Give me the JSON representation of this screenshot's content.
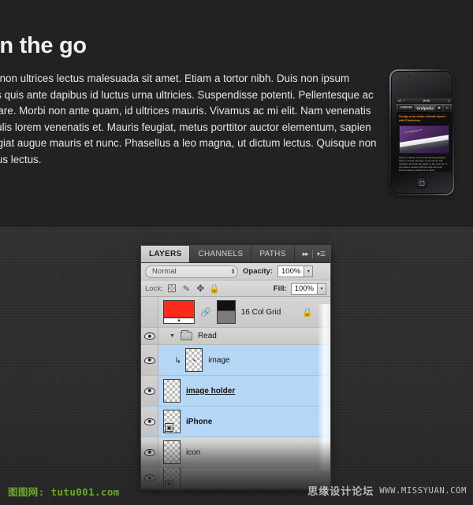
{
  "hero": {
    "heading": "on the go",
    "paragraph_lines": [
      "rci, non ultrices lectus malesuada sit amet. Etiam a tortor nibh. Duis non ipsum",
      "felis quis ante dapibus id luctus urna ultricies. Suspendisse potenti. Pellentesque ac",
      "ornare. Morbi non ante quam, id ultrices mauris. Vivamus ac mi elit. Nam venenatis",
      "iaculis lorem venenatis et. Mauris feugiat, metus porttitor auctor elementum, sapien",
      "feugiat augue mauris et nunc. Phasellus a leo magna, ut dictum lectus. Quisque non",
      "pibus lectus."
    ]
  },
  "phone": {
    "status": {
      "carrier": "ull. ?",
      "time": "18:46"
    },
    "app_bar": {
      "back_label": "Grafpedia",
      "title": "Grafpedia",
      "star_icon": "star-icon",
      "forward_icon": "chevron-right-icon"
    },
    "post": {
      "title": "Design a car dealer website layout with Photoshop",
      "image_caption": "www.grafpedia.com",
      "body": "Hello my friends. From today all things will get back to normal. We have moved all our VIP members from the old system to the new one. If you have a problem with the login and your account please contact us by email."
    }
  },
  "panel": {
    "tabs": [
      {
        "label": "LAYERS",
        "active": true
      },
      {
        "label": "CHANNELS",
        "active": false
      },
      {
        "label": "PATHS",
        "active": false
      }
    ],
    "tab_icons": {
      "collapse": "double-chevron-right-icon",
      "menu": "panel-menu-icon"
    },
    "blend": {
      "mode": "Normal",
      "opacity_label": "Opacity:",
      "opacity_value": "100%"
    },
    "lock": {
      "label": "Lock:",
      "icons": [
        "transparency-lock-icon",
        "brush-lock-icon",
        "move-lock-icon",
        "all-lock-icon"
      ],
      "fill_label": "Fill:",
      "fill_value": "100%"
    },
    "layers": [
      {
        "name": "16 Col Grid",
        "visible": false,
        "selected": false,
        "type": "layer-with-mask",
        "locked": true,
        "thumb": "red"
      },
      {
        "name": "Read",
        "visible": true,
        "selected": false,
        "type": "group",
        "expanded": true
      },
      {
        "name": "image",
        "visible": true,
        "selected": true,
        "type": "clipped-layer"
      },
      {
        "name": "image holder",
        "visible": true,
        "selected": true,
        "type": "layer",
        "underlined": true
      },
      {
        "name": "iPhone",
        "visible": true,
        "selected": true,
        "type": "smart-object"
      },
      {
        "name": "icon",
        "visible": true,
        "selected": false,
        "type": "layer"
      }
    ]
  },
  "watermarks": {
    "left": "图图网: tutu001.com",
    "right_cn": "思缘设计论坛",
    "right_url": "WWW.MISSYUAN.COM"
  }
}
